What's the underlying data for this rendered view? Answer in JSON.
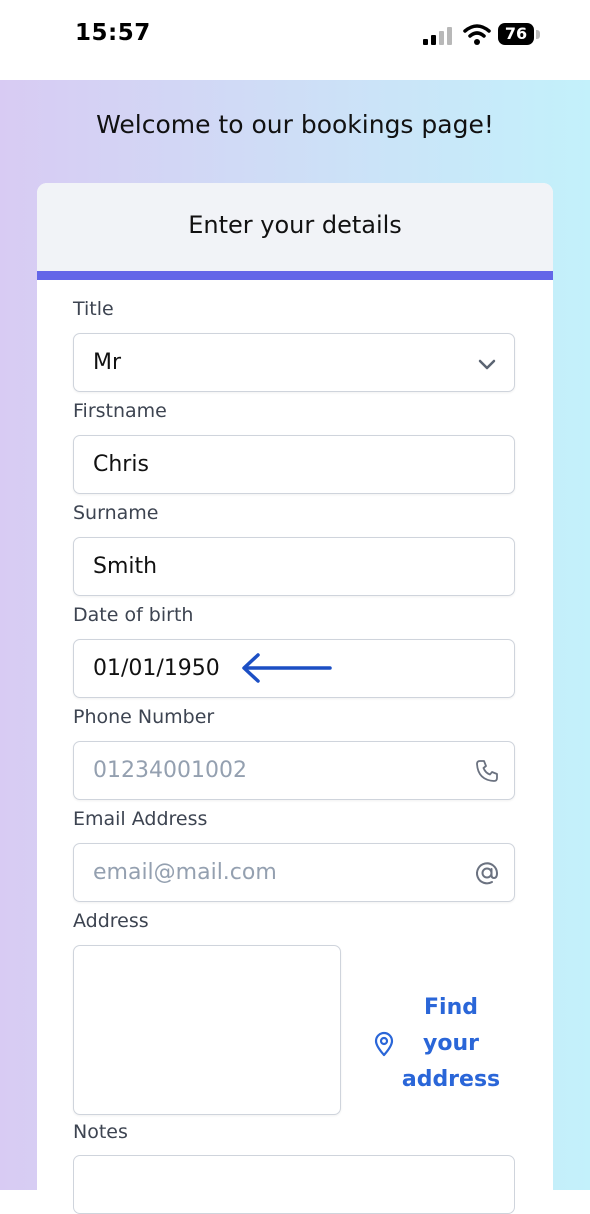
{
  "status_bar": {
    "time": "15:57",
    "battery": "76",
    "icons": [
      "signal-icon",
      "wifi-icon",
      "battery-icon"
    ]
  },
  "page": {
    "welcome": "Welcome to our bookings page!"
  },
  "card": {
    "title": "Enter your details",
    "accent_color": "#6366e8"
  },
  "form": {
    "title": {
      "label": "Title",
      "value": "Mr",
      "icon": "chevron-down-icon"
    },
    "firstname": {
      "label": "Firstname",
      "value": "Chris"
    },
    "surname": {
      "label": "Surname",
      "value": "Smith"
    },
    "dob": {
      "label": "Date of birth",
      "value": "01/01/1950",
      "annotation_icon": "arrow-left-icon"
    },
    "phone": {
      "label": "Phone Number",
      "placeholder": "01234001002",
      "icon": "phone-icon"
    },
    "email": {
      "label": "Email Address",
      "placeholder": "email@mail.com",
      "icon": "at-icon"
    },
    "address": {
      "label": "Address",
      "value": "",
      "find_button": "Find your address",
      "find_icon": "map-pin-icon",
      "find_color": "#2a66d8"
    },
    "notes": {
      "label": "Notes",
      "value": ""
    }
  }
}
